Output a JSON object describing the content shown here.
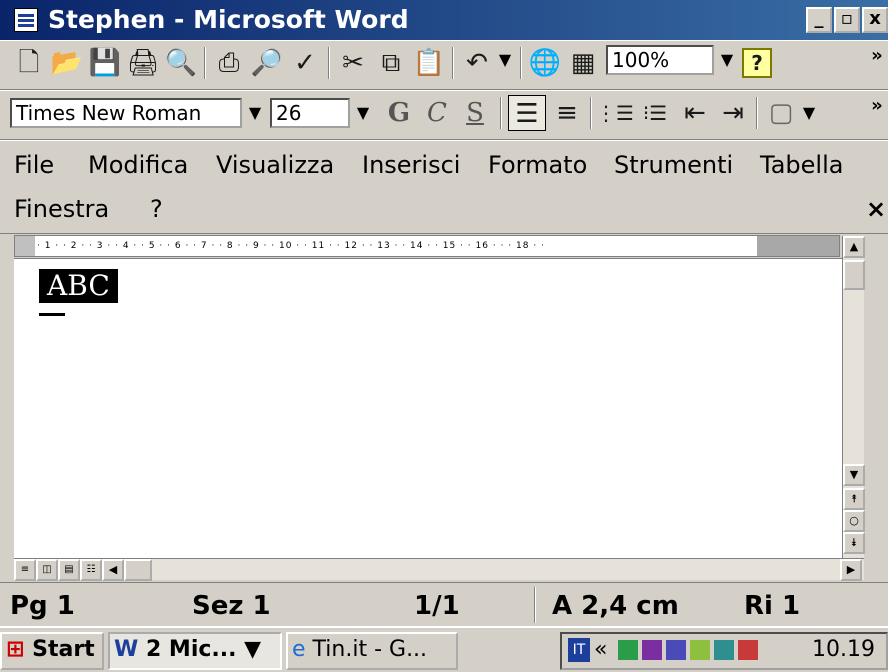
{
  "window": {
    "title": "Stephen - Microsoft Word",
    "minimize_label": "_",
    "restore_label": "▫",
    "close_label": "x"
  },
  "standard_toolbar": {
    "icons": [
      {
        "name": "new-document-icon",
        "glyph": "🗋"
      },
      {
        "name": "open-folder-icon",
        "glyph": "📂"
      },
      {
        "name": "save-icon",
        "glyph": "💾"
      },
      {
        "name": "print-setup-icon",
        "glyph": "🖨"
      },
      {
        "name": "search-web-icon",
        "glyph": "🔍"
      },
      {
        "name": "print-icon",
        "glyph": "⎙"
      },
      {
        "name": "print-preview-icon",
        "glyph": "🔎"
      },
      {
        "name": "spellcheck-icon",
        "glyph": "✓"
      },
      {
        "name": "cut-icon",
        "glyph": "✂"
      },
      {
        "name": "copy-icon",
        "glyph": "⧉"
      },
      {
        "name": "paste-icon",
        "glyph": "📋"
      },
      {
        "name": "undo-icon",
        "glyph": "↶"
      },
      {
        "name": "web-icon",
        "glyph": "🌐"
      },
      {
        "name": "table-icon",
        "glyph": "▦"
      },
      {
        "name": "help-icon",
        "glyph": "?"
      }
    ],
    "zoom_value": "100%"
  },
  "formatting_toolbar": {
    "font_name": "Times New Roman",
    "font_size": "26",
    "bold_label": "G",
    "italic_label": "C",
    "underline_label": "S",
    "icons": [
      {
        "name": "align-left-icon",
        "glyph": "☰"
      },
      {
        "name": "align-center-icon",
        "glyph": "≡"
      },
      {
        "name": "numbered-list-icon",
        "glyph": "⋮☰"
      },
      {
        "name": "bullet-list-icon",
        "glyph": "⁝☰"
      },
      {
        "name": "decrease-indent-icon",
        "glyph": "⇤"
      },
      {
        "name": "increase-indent-icon",
        "glyph": "⇥"
      },
      {
        "name": "borders-icon",
        "glyph": "▢"
      }
    ]
  },
  "menu": {
    "items": [
      "File",
      "Modifica",
      "Visualizza",
      "Inserisci",
      "Formato",
      "Strumenti",
      "Tabella",
      "Finestra",
      "?"
    ],
    "close_label": "×"
  },
  "ruler": {
    "ticks": "· 1 · · 2 · · 3 · · 4 · · 5 · · 6 · · 7 · · 8 · · 9 · · 10 · · 11 · · 12 · · 13 · · 14 · · 15 · · 16 · · · 18 · ·"
  },
  "document": {
    "text": "ABC"
  },
  "status": {
    "page": "Pg 1",
    "section": "Sez 1",
    "pages": "1/1",
    "position": "A 2,4 cm",
    "line": "Ri 1"
  },
  "taskbar": {
    "start_label": "Start",
    "buttons": [
      "2 Mic...",
      "Tin.it - G..."
    ],
    "language": "IT",
    "tray_expand": "«",
    "clock": "10.19"
  }
}
